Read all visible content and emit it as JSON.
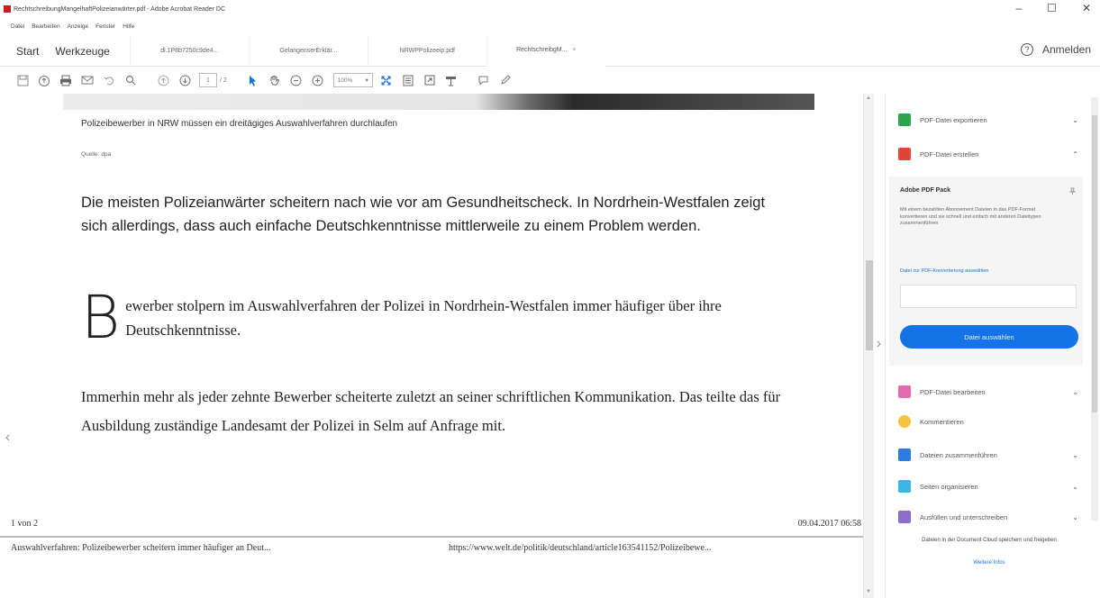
{
  "window": {
    "title": "RechtschreibungMangelhaftPolizeianwärter.pdf - Adobe Acrobat Reader DC",
    "controls": [
      "–",
      "☐",
      "✕"
    ]
  },
  "menu": [
    "Datei",
    "Bearbeiten",
    "Anzeige",
    "Fenster",
    "Hilfe"
  ],
  "tabs": {
    "home": "Start",
    "tools": "Werkzeuge",
    "documents": [
      {
        "label": "dl.1P8b7250c9de4..."
      },
      {
        "label": "GelangenserErklär..."
      },
      {
        "label": "NRWPPolizeeip.pdf"
      },
      {
        "label": "RechtschreibgM...",
        "active": true,
        "close": "×"
      }
    ],
    "help": "?",
    "signin": "Anmelden"
  },
  "toolbar": {
    "page_current": "1",
    "page_total": "/ 2",
    "zoom": "100%",
    "zoom_caret": "▾"
  },
  "document": {
    "caption": "Polizeibewerber in NRW müssen ein dreitägiges Auswahlverfahren durchlaufen",
    "source": "Quelle: dpa",
    "lead": "Die meisten Polizeianwärter scheitern nach wie vor am Gesundheitscheck. In Nordrhein-Westfalen zeigt sich allerdings, dass auch einfache Deutschkenntnisse mittlerweile zu einem Problem werden.",
    "dropcap": "B",
    "para1": "ewerber stolpern im Auswahlverfahren der Polizei in Nordrhein-Westfalen immer häufiger über ihre Deutschkenntnisse.",
    "para2": "Immerhin mehr als jeder zehnte Bewerber scheiterte zuletzt an seiner schriftlichen Kommunikation. Das teilte das für Ausbildung zuständige Landesamt der Polizei in Selm auf Anfrage mit.",
    "footer_page": "1 von 2",
    "footer_date": "09.04.2017 06:58",
    "header_title": "Auswahlverfahren: Polizeibewerber scheitern immer häufiger an Deut...",
    "header_url": "https://www.welt.de/politik/deutschland/article163541152/Polizeibewe..."
  },
  "right_pane": {
    "tools": [
      {
        "label": "PDF-Datei exportieren",
        "chevron": "⌄",
        "color": "#2da44e"
      },
      {
        "label": "PDF-Datei erstellen",
        "chevron": "⌃",
        "color": "#e0453a"
      },
      {
        "label": "PDF-Datei bearbeiten",
        "chevron": "⌄",
        "color": "#e06baf"
      },
      {
        "label": "Kommentieren",
        "chevron": "",
        "color": "#f3c341"
      },
      {
        "label": "Dateien zusammenführen",
        "chevron": "⌄",
        "color": "#2c7be5"
      },
      {
        "label": "Seiten organisieren",
        "chevron": "⌄",
        "color": "#3bb6e6"
      },
      {
        "label": "Ausfüllen und unterschreiben",
        "chevron": "⌄",
        "color": "#8e6cc9"
      }
    ],
    "pdf_pack": {
      "title": "Adobe PDF Pack",
      "description": "Mit einem bezahlten Abonnement Dateien in das PDF-Format konvertieren und sie schnell und einfach mit anderen Dateitypen zusammenführen",
      "link": "Datei zur PDF-Konvertierung auswählen",
      "button": "Datei auswählen"
    },
    "cloud_text": "Dateien in der Document Cloud speichern und freigeben",
    "cloud_link": "Weitere Infos"
  }
}
